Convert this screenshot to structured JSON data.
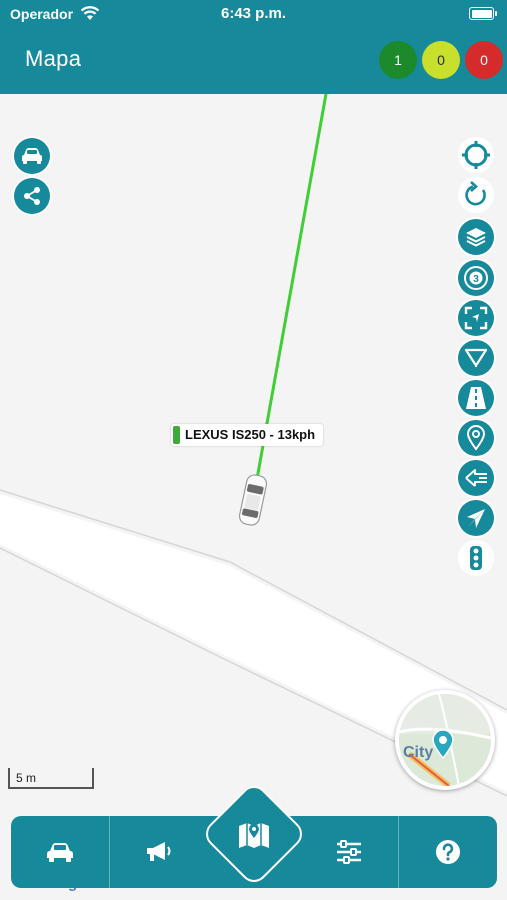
{
  "status_bar": {
    "carrier": "Operador",
    "time": "6:43 p.m."
  },
  "header": {
    "title": "Mapa",
    "counters": [
      {
        "value": "1",
        "color": "#1c8a2a"
      },
      {
        "value": "0",
        "color": "#c8e02c"
      },
      {
        "value": "0",
        "color": "#d52b2b"
      }
    ]
  },
  "map": {
    "vehicle_label": "LEXUS IS250 - 13kph",
    "scale_label": "5 m",
    "minimap_label": "City",
    "route_color": "#3fce34",
    "attribution": "Google"
  },
  "left_buttons": [
    {
      "icon": "car-icon"
    },
    {
      "icon": "share-icon"
    }
  ],
  "right_tools": [
    {
      "icon": "crosshair-icon"
    },
    {
      "icon": "refresh-icon"
    },
    {
      "icon": "layers-icon"
    },
    {
      "icon": "count-badge-icon",
      "value": "3"
    },
    {
      "icon": "fit-bounds-icon"
    },
    {
      "icon": "filter-icon"
    },
    {
      "icon": "road-icon"
    },
    {
      "icon": "pin-icon"
    },
    {
      "icon": "route-arrow-icon"
    },
    {
      "icon": "navigate-icon"
    },
    {
      "icon": "traffic-light-icon"
    }
  ],
  "bottom_nav": [
    {
      "icon": "car-icon"
    },
    {
      "icon": "megaphone-icon"
    },
    {
      "icon": "map-icon",
      "active": true
    },
    {
      "icon": "sliders-icon"
    },
    {
      "icon": "help-icon"
    }
  ],
  "colors": {
    "primary": "#16899b",
    "map_bg": "#f4f4f5"
  }
}
